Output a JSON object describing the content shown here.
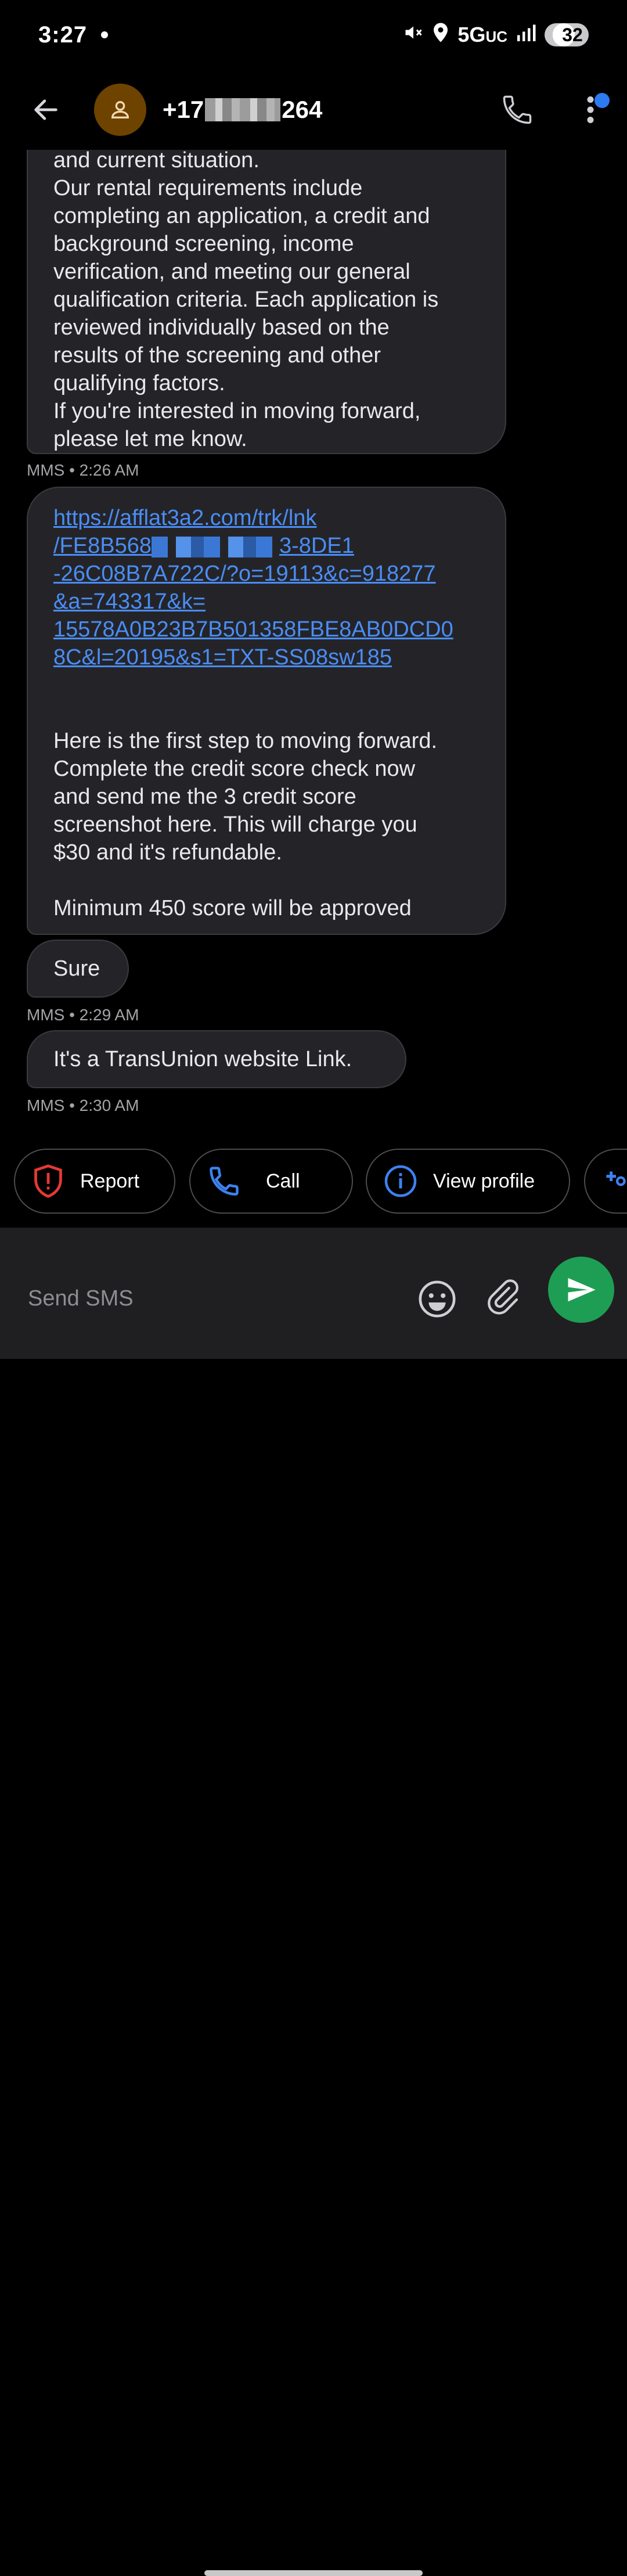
{
  "status_bar": {
    "time": "3:27",
    "network": "5G",
    "network_suffix": "UC",
    "battery": "32"
  },
  "header": {
    "contact_prefix": "+17",
    "contact_suffix": "264"
  },
  "messages": [
    {
      "id": "msg1",
      "lines": [
        "and current situation.",
        "Our rental requirements include",
        "completing an application, a credit and",
        "background screening, income",
        "verification, and meeting our general",
        "qualification criteria. Each application is",
        "reviewed individually based on the",
        "results of the screening and other",
        "qualifying factors.",
        "If you're interested in moving forward,",
        "please let me know."
      ],
      "meta": "MMS • 2:26 AM"
    },
    {
      "id": "msg2",
      "link_lines": [
        "https://afflat3a2.com/trk/lnk",
        "/FE8B568",
        "3-8DE1",
        "-26C08B7A722C/?o=19113&c=918277",
        "&a=743317&k=",
        "15578A0B23B7B501358FBE8AB0DCD0",
        "8C&l=20195&s1=TXT-SS08sw185"
      ],
      "body_lines": [
        "Here is the first step to moving forward.",
        "Complete the credit score check now",
        "and send me the 3 credit score",
        "screenshot here. This will charge you",
        "$30 and it's refundable."
      ],
      "footer": "Minimum 450 score will be approved"
    },
    {
      "id": "msg3",
      "text": "Sure",
      "meta": "MMS • 2:29 AM"
    },
    {
      "id": "msg4",
      "text": "It's a TransUnion website Link.",
      "meta": "MMS • 2:30 AM"
    }
  ],
  "chips": {
    "report": "Report",
    "call": "Call",
    "view_profile": "View profile"
  },
  "composer": {
    "placeholder": "Send SMS"
  },
  "colors": {
    "accent_blue": "#4a8df5",
    "send_green": "#1e9e54",
    "report_red": "#e53935",
    "avatar_brown": "#6e4300"
  },
  "icons": [
    "back-arrow-icon",
    "person-icon",
    "phone-icon",
    "more-vert-icon",
    "shield-alert-icon",
    "info-icon",
    "emoji-icon",
    "attach-icon",
    "send-icon",
    "mute-icon",
    "location-icon",
    "signal-icon"
  ]
}
